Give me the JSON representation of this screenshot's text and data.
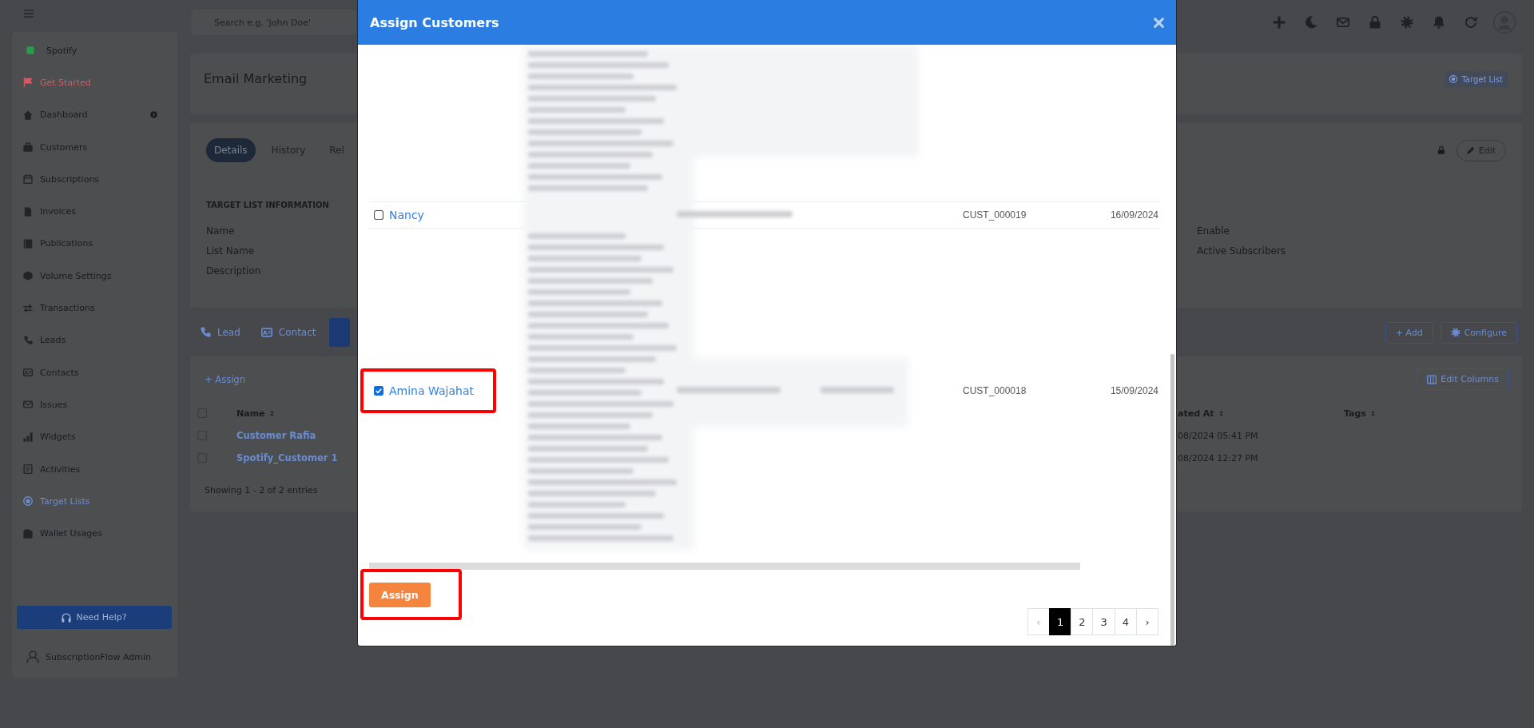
{
  "topbar": {
    "search": {
      "placeholder": "Search e.g. 'John Doe'"
    }
  },
  "sidebar": {
    "items": [
      {
        "label": "Spotify",
        "kind": "workspace",
        "selected": false,
        "submenu": false
      },
      {
        "label": "Get Started",
        "kind": "alert",
        "selected": false,
        "submenu": false
      },
      {
        "label": "Dashboard",
        "kind": "nav",
        "selected": false,
        "submenu": true
      },
      {
        "label": "Customers",
        "kind": "nav",
        "selected": false,
        "submenu": false
      },
      {
        "label": "Subscriptions",
        "kind": "nav",
        "selected": false,
        "submenu": false
      },
      {
        "label": "Invoices",
        "kind": "nav",
        "selected": false,
        "submenu": false
      },
      {
        "label": "Publications",
        "kind": "nav",
        "selected": false,
        "submenu": false
      },
      {
        "label": "Volume Settings",
        "kind": "nav",
        "selected": false,
        "submenu": false
      },
      {
        "label": "Transactions",
        "kind": "nav",
        "selected": false,
        "submenu": false
      },
      {
        "label": "Leads",
        "kind": "nav",
        "selected": false,
        "submenu": false
      },
      {
        "label": "Contacts",
        "kind": "nav",
        "selected": false,
        "submenu": false
      },
      {
        "label": "Issues",
        "kind": "nav",
        "selected": false,
        "submenu": false
      },
      {
        "label": "Widgets",
        "kind": "nav",
        "selected": false,
        "submenu": false
      },
      {
        "label": "Activities",
        "kind": "nav",
        "selected": false,
        "submenu": false
      },
      {
        "label": "Target Lists",
        "kind": "nav",
        "selected": true,
        "submenu": false
      },
      {
        "label": "Wallet Usages",
        "kind": "nav",
        "selected": false,
        "submenu": false
      }
    ],
    "help_button": "Need Help?",
    "user": "SubscriptionFlow Admin"
  },
  "header_card": {
    "title": "Email Marketing",
    "button": "Target List"
  },
  "details_card": {
    "tabs": [
      {
        "label": "Details",
        "selected": true
      },
      {
        "label": "History",
        "selected": false
      },
      {
        "label": "Rel",
        "selected": false
      }
    ],
    "edit_button": "Edit",
    "section_title": "TARGET LIST INFORMATION",
    "left_labels": [
      "Name",
      "List Name",
      "Description"
    ],
    "right_labels": [
      "Enable",
      "Active Subscribers"
    ]
  },
  "related_tabs": {
    "tabs": [
      {
        "label": "Lead",
        "selected": false
      },
      {
        "label": "Contact",
        "selected": false
      },
      {
        "selected": true
      }
    ],
    "add_button": "+ Add",
    "configure_button": "Configure"
  },
  "related_table": {
    "assign_link": "+ Assign",
    "edit_columns_button": "Edit Columns",
    "all_checked": false,
    "columns": [
      "Name",
      "ated At",
      "Tags"
    ],
    "rows": [
      {
        "checked": false,
        "name": "Customer Rafia",
        "column_2": "08/2024 05:41 PM"
      },
      {
        "checked": false,
        "name": "Spotify_Customer 1",
        "column_2": "08/2024 12:27 PM"
      }
    ],
    "footer": "Showing 1 - 2 of 2 entries"
  },
  "modal": {
    "title": "Assign Customers",
    "rows": [
      {
        "checked": false,
        "highlighted": false,
        "name": "Nancy",
        "customer_id": "CUST_000019",
        "date": "16/09/2024"
      },
      {
        "checked": true,
        "highlighted": true,
        "name": "Amina Wajahat",
        "customer_id": "CUST_000018",
        "date": "15/09/2024"
      }
    ],
    "assign_button": {
      "label": "Assign",
      "highlighted": true
    },
    "pagination": {
      "prev": {
        "label": "‹",
        "disabled": true
      },
      "pages": [
        {
          "label": "1",
          "selected": true
        },
        {
          "label": "2",
          "selected": false
        },
        {
          "label": "3",
          "selected": false
        },
        {
          "label": "4",
          "selected": false
        }
      ],
      "next": {
        "label": "›",
        "disabled": false
      }
    }
  }
}
